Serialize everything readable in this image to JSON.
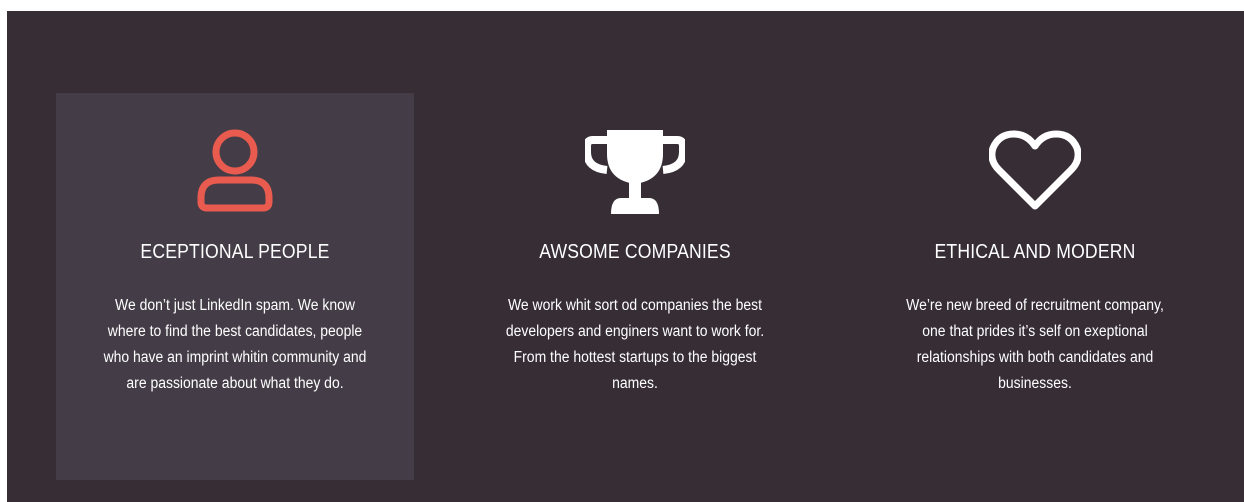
{
  "colors": {
    "section_bg": "#362d35",
    "active_card_bg": "#443d48",
    "accent": "#e95a4f",
    "text": "#ffffff"
  },
  "features": [
    {
      "icon": "user-icon",
      "title": "ECEPTIONAL PEOPLE",
      "text": "We don’t just LinkedIn spam. We know where to find the best candidates, people who have an imprint whitin community and are passionate about what they do.",
      "active": true
    },
    {
      "icon": "trophy-icon",
      "title": "AWSOME COMPANIES",
      "text": "We work whit sort od companies the best developers and enginers want to work for. From the hottest startups to the biggest names.",
      "active": false
    },
    {
      "icon": "heart-icon",
      "title": "ETHICAL AND MODERN",
      "text": "We’re new breed of recruitment company, one that prides it’s self on exeptional relationships with both candidates and businesses.",
      "active": false
    }
  ]
}
